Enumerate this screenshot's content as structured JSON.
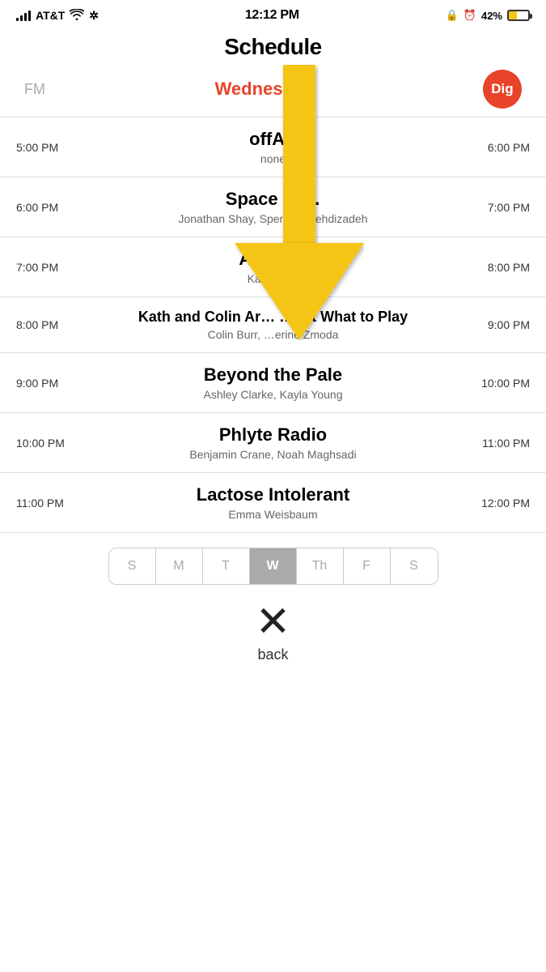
{
  "statusBar": {
    "carrier": "AT&T",
    "time": "12:12 PM",
    "batteryPercent": "42%"
  },
  "page": {
    "title": "Schedule"
  },
  "header": {
    "fm": "FM",
    "day": "Wednesday",
    "badge": "Dig"
  },
  "schedule": [
    {
      "startTime": "5:00 PM",
      "endTime": "6:00 PM",
      "title": "offAir",
      "hosts": "none"
    },
    {
      "startTime": "6:00 PM",
      "endTime": "7:00 PM",
      "title": "Space Ja…",
      "hosts": "Jonathan Shay, Spenc… Mehdizadeh"
    },
    {
      "startTime": "7:00 PM",
      "endTime": "8:00 PM",
      "title": "Art H…r",
      "hosts": "Ka…   …ux"
    },
    {
      "startTime": "8:00 PM",
      "endTime": "9:00 PM",
      "title": "Kath and Colin Ar… …out What to Play",
      "hosts": "Colin Burr, …erine Zmoda"
    },
    {
      "startTime": "9:00 PM",
      "endTime": "10:00 PM",
      "title": "Beyond the Pale",
      "hosts": "Ashley Clarke, Kayla Young"
    },
    {
      "startTime": "10:00 PM",
      "endTime": "11:00 PM",
      "title": "Phlyte Radio",
      "hosts": "Benjamin Crane, Noah Maghsadi"
    },
    {
      "startTime": "11:00 PM",
      "endTime": "12:00 PM",
      "title": "Lactose Intolerant",
      "hosts": "Emma Weisbaum"
    }
  ],
  "days": [
    {
      "label": "S",
      "active": false
    },
    {
      "label": "M",
      "active": false
    },
    {
      "label": "T",
      "active": false
    },
    {
      "label": "W",
      "active": true
    },
    {
      "label": "Th",
      "active": false
    },
    {
      "label": "F",
      "active": false
    },
    {
      "label": "S",
      "active": false
    }
  ],
  "back": {
    "label": "back",
    "icon": "✕"
  }
}
